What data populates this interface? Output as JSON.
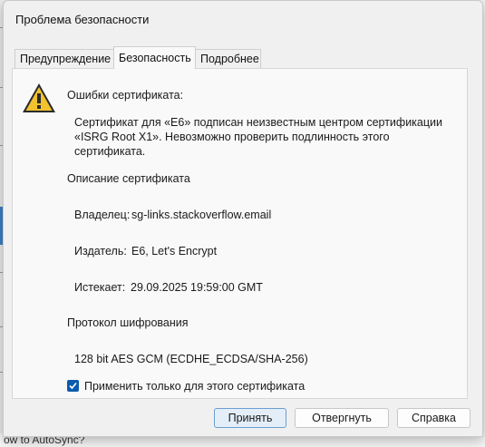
{
  "dialog": {
    "title": "Проблема безопасности"
  },
  "tabs": [
    {
      "label": "Предупреждение",
      "active": false
    },
    {
      "label": "Безопасность",
      "active": true
    },
    {
      "label": "Подробнее",
      "active": false
    }
  ],
  "security": {
    "errors_heading": "Ошибки сертификата:",
    "errors_text": "Сертификат для «E6» подписан неизвестным центром сертификации «ISRG Root X1». Невозможно проверить подлинность этого сертификата.",
    "cert_description_heading": "Описание сертификата",
    "owner_label": "Владелец:",
    "owner_value": "sg-links.stackoverflow.email",
    "issuer_label": "Издатель:",
    "issuer_value": "E6, Let's Encrypt",
    "expires_label": "Истекает:",
    "expires_value": "29.09.2025 19:59:00 GMT",
    "protocol_heading": "Протокол шифрования",
    "protocol_value": "128 bit AES GCM (ECDHE_ECDSA/SHA-256)",
    "apply_only_label": "Применить только для этого сертификата",
    "apply_only_checked": true
  },
  "buttons": {
    "accept": "Принять",
    "reject": "Отвергнуть",
    "help": "Справка"
  },
  "background": {
    "partial_text": "ow to AutoSync?"
  },
  "colors": {
    "accent": "#0b5cad",
    "warning": "#f2c12e"
  }
}
